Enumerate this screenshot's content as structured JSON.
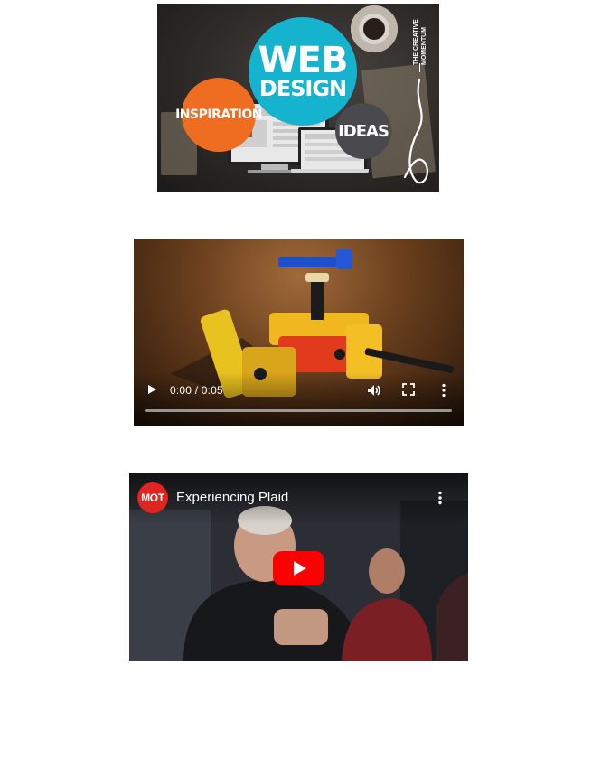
{
  "graphic": {
    "headline_line1": "WEB",
    "headline_line2": "DESIGN",
    "left_bubble": "INSPIRATION",
    "right_bubble": "IDEAS",
    "brand": "THE CREATIVE MOMENTUM",
    "colors": {
      "web_circle": "#16b3cf",
      "inspiration_circle": "#ef6d21",
      "ideas_circle": "#4a4a4e"
    }
  },
  "video_player": {
    "time_display": "0:00 / 0:05",
    "icons": [
      "play-icon",
      "volume-icon",
      "fullscreen-icon",
      "more-options-icon"
    ],
    "progress": 0
  },
  "youtube_embed": {
    "channel_avatar_text": "MOT",
    "video_title": "Experiencing Plaid",
    "icons": [
      "youtube-play-icon",
      "more-options-icon"
    ],
    "colors": {
      "play_button": "#ff0000",
      "avatar": "#e02420"
    }
  }
}
